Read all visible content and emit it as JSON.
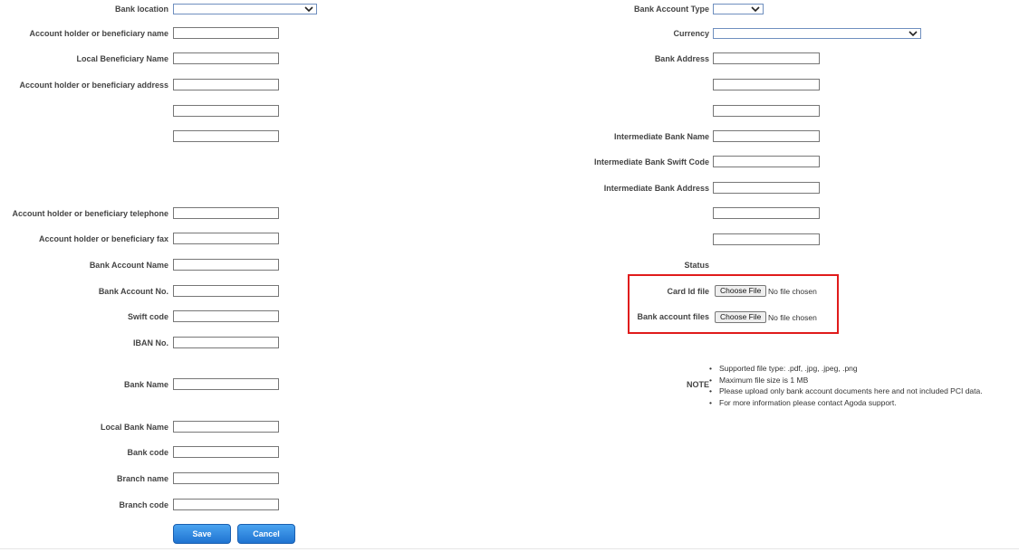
{
  "left_form": {
    "bank_location": "Bank location",
    "holder_name": "Account holder or beneficiary name",
    "local_beneficiary_name": "Local Beneficiary Name",
    "holder_address": "Account holder or beneficiary address",
    "holder_telephone": "Account holder or beneficiary telephone",
    "holder_fax": "Account holder or beneficiary fax",
    "bank_account_name": "Bank Account Name",
    "bank_account_no": "Bank Account No.",
    "swift_code": "Swift code",
    "iban_no": "IBAN No.",
    "bank_name": "Bank Name",
    "local_bank_name": "Local Bank Name",
    "bank_code": "Bank code",
    "branch_name": "Branch name",
    "branch_code": "Branch code"
  },
  "right_form": {
    "bank_account_type": "Bank Account Type",
    "currency": "Currency",
    "bank_address": "Bank Address",
    "intermediate_bank_name": "Intermediate Bank Name",
    "intermediate_bank_swift": "Intermediate Bank Swift Code",
    "intermediate_bank_address": "Intermediate Bank Address",
    "status": "Status"
  },
  "uploads": {
    "card_id_label": "Card Id file",
    "bank_account_files_label": "Bank account files",
    "choose_file": "Choose File",
    "no_file": "No file chosen"
  },
  "note": {
    "label": "NOTE",
    "items": [
      "Supported file type: .pdf, .jpg, .jpeg, .png",
      "Maximum file size is 1 MB",
      "Please upload only bank account documents here and not included PCI data.",
      "For more information please contact Agoda support."
    ]
  },
  "actions": {
    "save": "Save",
    "cancel": "Cancel"
  },
  "colors": {
    "highlight": "#e01b1b",
    "button": "#2a84e0"
  }
}
